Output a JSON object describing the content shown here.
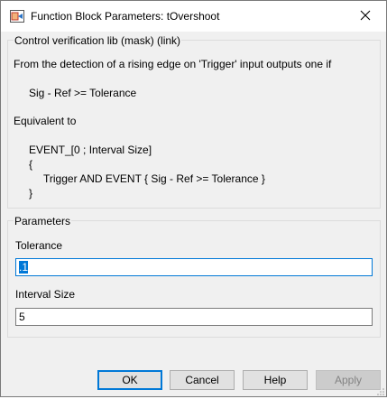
{
  "window": {
    "title": "Function Block Parameters: tOvershoot",
    "icon": "simulink-block-icon"
  },
  "description_group": {
    "label": "Control verification lib (mask) (link)",
    "lines": [
      "From the detection of a rising edge on 'Trigger' input outputs one if",
      "Sig - Ref >= Tolerance",
      "Equivalent to",
      "EVENT_[0 ; Interval Size]",
      "{",
      "Trigger AND EVENT { Sig - Ref >= Tolerance }",
      "}"
    ]
  },
  "parameters_group": {
    "label": "Parameters",
    "tolerance": {
      "label": "Tolerance",
      "value": "1",
      "selected_text": ".1"
    },
    "interval_size": {
      "label": "Interval Size",
      "value": "5"
    }
  },
  "buttons": {
    "ok": "OK",
    "cancel": "Cancel",
    "help": "Help",
    "apply": "Apply"
  },
  "colors": {
    "accent": "#0078d7",
    "dialog_bg": "#f0f0f0",
    "disabled_text": "#838383"
  }
}
